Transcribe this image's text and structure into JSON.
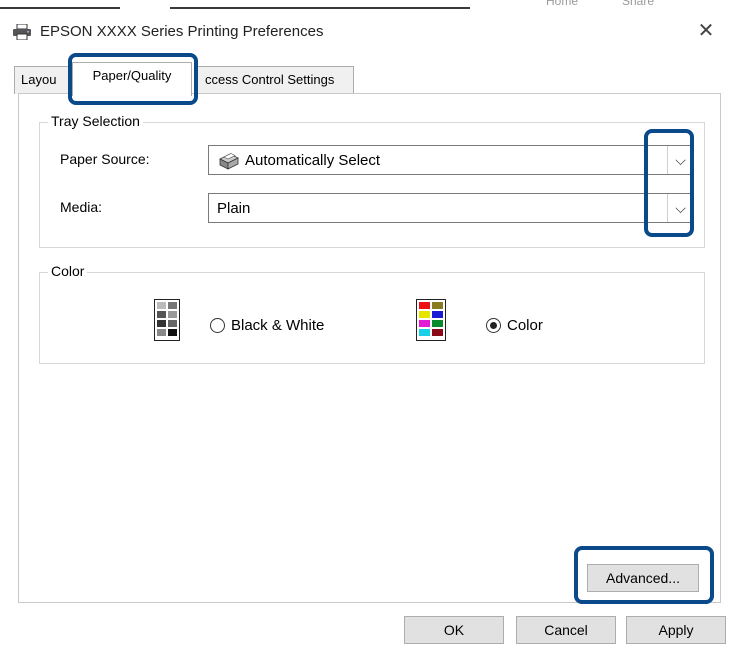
{
  "window": {
    "title": "EPSON XXXX  Series Printing Preferences",
    "close_glyph": "✕",
    "background_hints": [
      "Home",
      "Share"
    ]
  },
  "tabs": [
    {
      "label": "Layou"
    },
    {
      "label": "Paper/Quality",
      "active": true
    },
    {
      "label": "ccess Control Settings"
    }
  ],
  "tray_selection": {
    "legend": "Tray Selection",
    "paper_source": {
      "label": "Paper Source:",
      "value": "Automatically Select",
      "icon": "printer-tray-icon"
    },
    "media": {
      "label": "Media:",
      "value": "Plain"
    },
    "dropdown_glyph": "⌵"
  },
  "color": {
    "legend": "Color",
    "options": [
      {
        "label": "Black & White",
        "selected": false,
        "icon": "grayscale-palette-icon"
      },
      {
        "label": "Color",
        "selected": true,
        "icon": "color-palette-icon"
      }
    ]
  },
  "buttons": {
    "advanced": "Advanced...",
    "ok": "OK",
    "cancel": "Cancel",
    "apply": "Apply"
  },
  "colors": {
    "highlight": "#0b4a8a"
  }
}
